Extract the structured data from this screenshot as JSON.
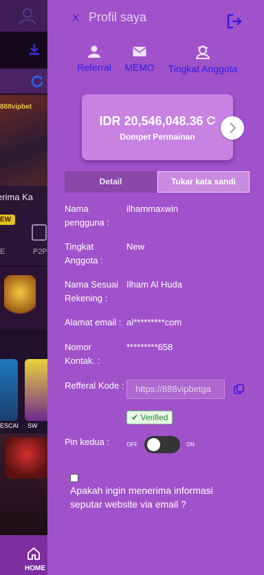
{
  "background": {
    "marquee_text": "erima Ka",
    "new_badge": "EW",
    "cat_left": "E",
    "cat_p2p": "P2P",
    "game_label_1": "ESCAI",
    "game_label_2": "SW",
    "home_label": "HOME"
  },
  "panel": {
    "close_label": "X",
    "title": "Profil saya",
    "nav": {
      "referral": "Referral",
      "memo": "MEMO",
      "tingkat": "Tingkat Anggota"
    },
    "wallet": {
      "amount": "IDR 20,546,048.36",
      "label": "Dompet Permainan"
    },
    "tabs": {
      "detail": "Detail",
      "password": "Tukar kata sandi"
    },
    "fields": {
      "username_label": "Nama pengguna :",
      "username_value": "ilhammaxwin",
      "level_label": "Tingkat Anggota :",
      "level_value": "New",
      "account_name_label": "Nama Sesuai Rekening :",
      "account_name_value": "Ilham Al Huda",
      "email_label": "Alamat email :",
      "email_value": "al*********com",
      "phone_label": "Nomor Kontak. :",
      "phone_value": "*********658",
      "referral_label": "Refferal Kode :",
      "referral_value": "https://888vipbetga",
      "verified_label": "Verified",
      "pin_label": "Pin kedua :",
      "pin_off": "OFF",
      "pin_on": "ON",
      "pin_enabled": false
    },
    "email_question": "Apakah ingin menerima informasi seputar website via email ?",
    "email_opt_in": false
  },
  "colors": {
    "panel_bg": "#a052ca",
    "accent_blue": "#2f1be4",
    "wallet_card": "#c782e2",
    "verified_green": "#2a8a30"
  }
}
